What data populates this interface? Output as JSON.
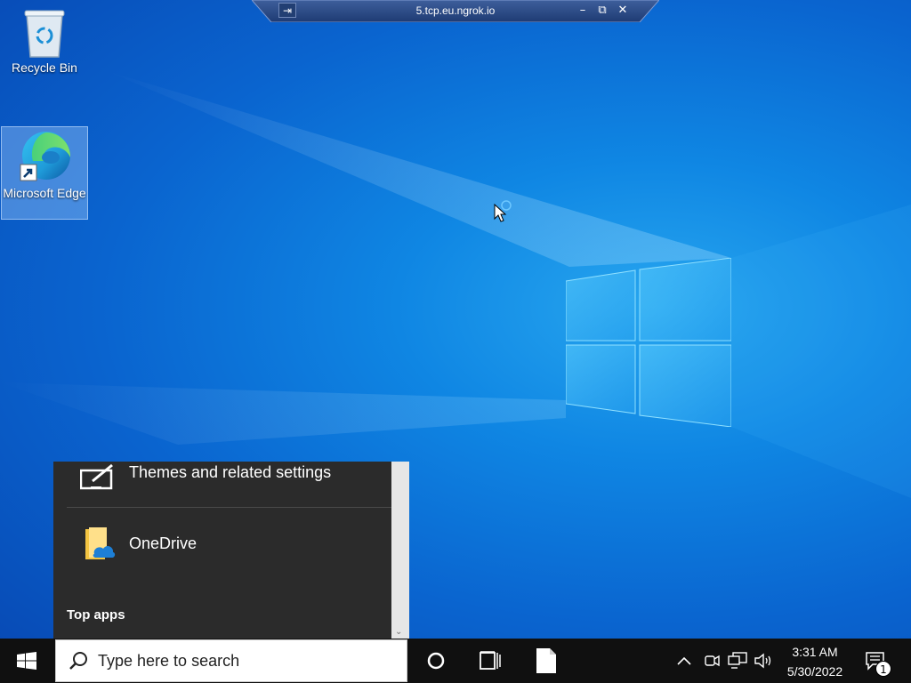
{
  "rdp_bar": {
    "title": "5.tcp.eu.ngrok.io",
    "minimize": "–",
    "restore": "⧉",
    "close": "✕"
  },
  "desktop": {
    "icons": [
      {
        "label": "Recycle Bin"
      },
      {
        "label": "Microsoft Edge",
        "selected": true
      }
    ]
  },
  "start_panel": {
    "items": [
      {
        "label": "Themes and related settings",
        "icon": "themes-settings-icon"
      },
      {
        "label": "OneDrive",
        "icon": "onedrive-folder-icon"
      }
    ],
    "section_header": "Top apps"
  },
  "taskbar": {
    "search_placeholder": "Type here to search",
    "time": "3:31 AM",
    "date": "5/30/2022",
    "notification_count": "1"
  },
  "colors": {
    "accent": "#0a64cf",
    "taskbar": "#101010",
    "panel": "#2b2b2b"
  }
}
